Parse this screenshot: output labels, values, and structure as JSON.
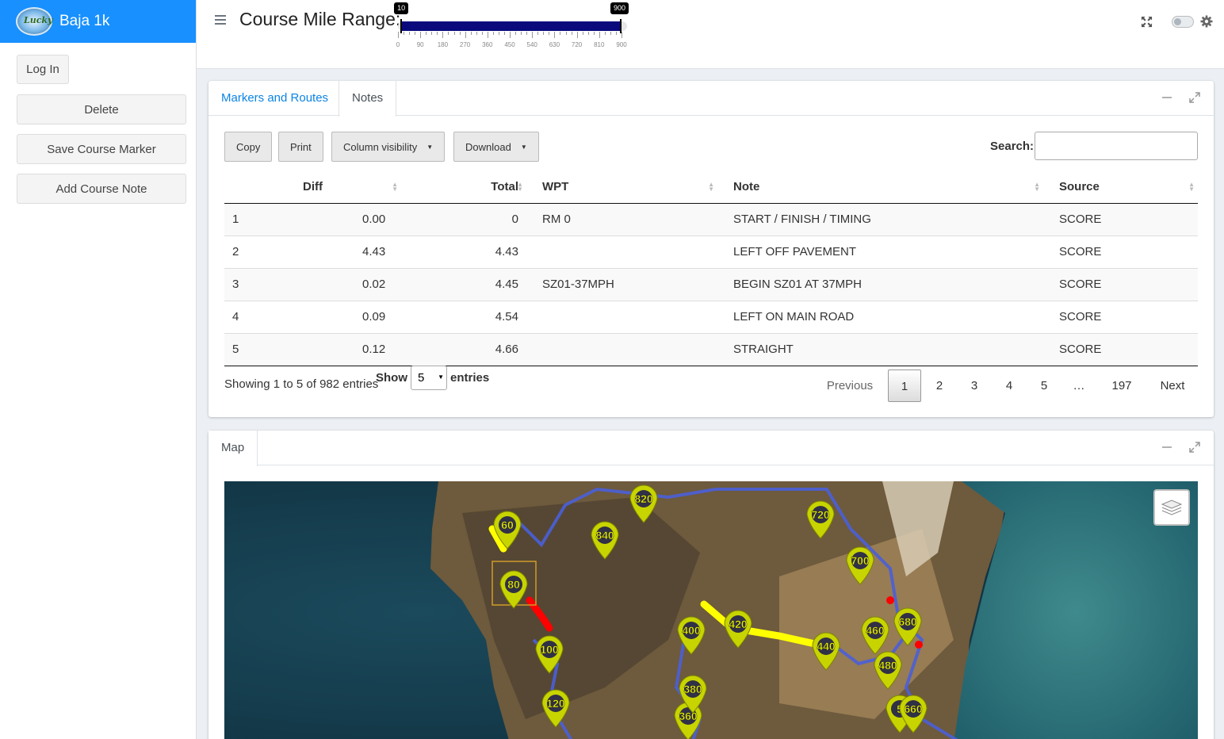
{
  "sidebar": {
    "brand_title": "Baja 1k",
    "logo_text": "Lucky",
    "buttons": {
      "login": "Log In",
      "delete": "Delete",
      "save_marker": "Save Course Marker",
      "add_note": "Add Course Note"
    }
  },
  "header": {
    "range_title": "Course Mile Range:",
    "slider": {
      "min": 0,
      "max": 900,
      "from": 10,
      "to": 900,
      "from_label": "10",
      "to_label": "900",
      "ticks": [
        "0",
        "90",
        "180",
        "270",
        "360",
        "450",
        "540",
        "630",
        "720",
        "810",
        "900"
      ]
    }
  },
  "notes_card": {
    "tabs": [
      "Markers and Routes",
      "Notes"
    ],
    "buttons": {
      "copy": "Copy",
      "print": "Print",
      "colvis": "Column visibility",
      "download": "Download"
    },
    "search_label": "Search:",
    "columns": [
      "",
      "Diff",
      "Total",
      "WPT",
      "Note",
      "Source"
    ],
    "rows": [
      [
        "1",
        "0.00",
        "0",
        "RM 0",
        "START / FINISH / TIMING",
        "SCORE"
      ],
      [
        "2",
        "4.43",
        "4.43",
        "",
        "LEFT OFF PAVEMENT",
        "SCORE"
      ],
      [
        "3",
        "0.02",
        "4.45",
        "SZ01-37MPH",
        "BEGIN SZ01 AT 37MPH",
        "SCORE"
      ],
      [
        "4",
        "0.09",
        "4.54",
        "",
        "LEFT ON MAIN ROAD",
        "SCORE"
      ],
      [
        "5",
        "0.12",
        "4.66",
        "",
        "STRAIGHT",
        "SCORE"
      ]
    ],
    "info": "Showing 1 to 5 of 982 entries",
    "show_label": "Show",
    "entries_label": "entries",
    "page_length": "5",
    "pagination": {
      "previous": "Previous",
      "pages": [
        "1",
        "2",
        "3",
        "4",
        "5",
        "…",
        "197"
      ],
      "next": "Next"
    }
  },
  "map_card": {
    "tab": "Map",
    "markers": [
      "60",
      "80",
      "100",
      "120",
      "360",
      "380",
      "400",
      "420",
      "440",
      "460",
      "480",
      "5",
      "660",
      "680",
      "700",
      "720",
      "820",
      "840"
    ]
  },
  "colors": {
    "brand": "#1890ff",
    "link": "#0c84e4",
    "slider_fill": "#0a0a7d",
    "route_blue": "#4a5fd8",
    "route_yellow": "#ffff00",
    "route_red": "#ff0000",
    "marker_fill": "#c8d400"
  }
}
